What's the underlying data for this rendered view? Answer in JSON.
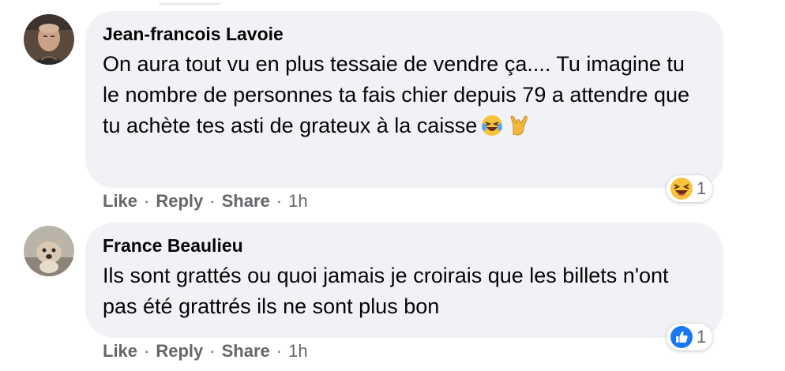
{
  "comments": [
    {
      "author": "Jean-francois Lavoie",
      "text": "On aura tout vu en plus tessaie de vendre ça.... Tu imagine tu le nombre de personnes ta fais chier depuis 79 a attendre que tu achète tes asti de grateux à la caisse",
      "emojis": [
        "grinning-squinting-face-with-tears",
        "love-you-gesture"
      ],
      "reaction": {
        "icon": "haha-reaction-icon",
        "count": "1"
      },
      "actions": {
        "like": "Like",
        "reply": "Reply",
        "share": "Share",
        "separator": "·",
        "time": "1h"
      }
    },
    {
      "author": "France Beaulieu",
      "text": "Ils sont grattés ou quoi jamais je croirais que les billets n'ont pas été grattrés ils ne sont plus bon",
      "emojis": [],
      "reaction": {
        "icon": "like-reaction-icon",
        "count": "1"
      },
      "actions": {
        "like": "Like",
        "reply": "Reply",
        "share": "Share",
        "separator": "·",
        "time": "1h"
      }
    }
  ],
  "colors": {
    "bubble_bg": "#f0f2f5",
    "text": "#050505",
    "meta": "#65676b",
    "like_blue": "#1877f2",
    "haha_yellow": "#f7c33b"
  }
}
